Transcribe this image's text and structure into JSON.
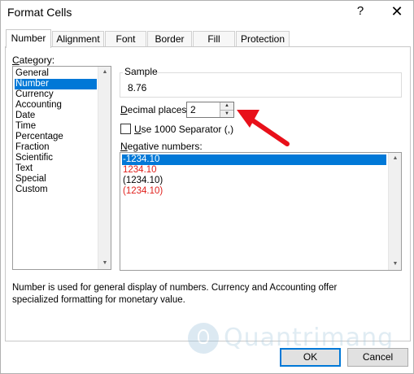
{
  "window": {
    "title": "Format Cells",
    "help_glyph": "?",
    "close_glyph": "✕"
  },
  "tabs": [
    {
      "label": "Number",
      "active": true
    },
    {
      "label": "Alignment",
      "active": false
    },
    {
      "label": "Font",
      "active": false
    },
    {
      "label": "Border",
      "active": false
    },
    {
      "label": "Fill",
      "active": false
    },
    {
      "label": "Protection",
      "active": false
    }
  ],
  "category": {
    "label_prefix": "",
    "label_underlined": "C",
    "label_rest": "ategory:",
    "items": [
      "General",
      "Number",
      "Currency",
      "Accounting",
      "Date",
      "Time",
      "Percentage",
      "Fraction",
      "Scientific",
      "Text",
      "Special",
      "Custom"
    ],
    "selected": "Number"
  },
  "sample": {
    "label": "Sample",
    "value": "8.76"
  },
  "decimal_places": {
    "label_underlined": "D",
    "label_rest": "ecimal places:",
    "value": "2"
  },
  "separator": {
    "label_underlined": "U",
    "label_rest": "se 1000 Separator (,)",
    "checked": false
  },
  "negative_numbers": {
    "label_underlined": "N",
    "label_rest": "egative numbers:",
    "items": [
      {
        "text": "-1234.10",
        "color": "#000000",
        "selected": true
      },
      {
        "text": "1234.10",
        "color": "#e0201c",
        "selected": false
      },
      {
        "text": "(1234.10)",
        "color": "#000000",
        "selected": false
      },
      {
        "text": "(1234.10)",
        "color": "#e0201c",
        "selected": false
      }
    ]
  },
  "description": "Number is used for general display of numbers.  Currency and Accounting offer specialized formatting for monetary value.",
  "buttons": {
    "ok": "OK",
    "cancel": "Cancel"
  },
  "annotation": {
    "arrow_color": "#e8101a"
  },
  "watermark": {
    "text": "Quantrimang"
  },
  "colors": {
    "selection": "#0078d7",
    "negative_red": "#e0201c"
  }
}
